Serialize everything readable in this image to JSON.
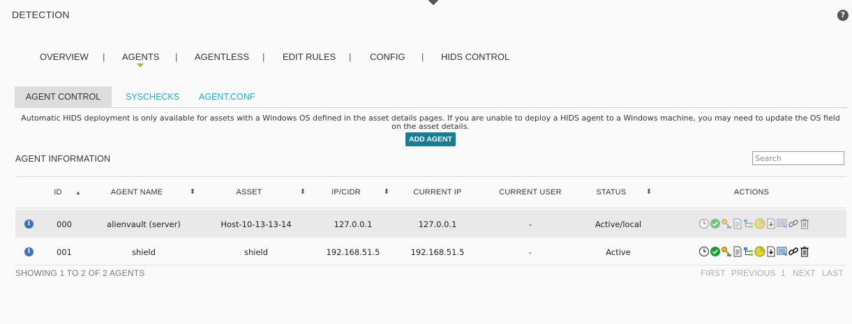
{
  "page": {
    "title": "DETECTION",
    "help_glyph": "?"
  },
  "main_nav": {
    "items": [
      "OVERVIEW",
      "AGENTS",
      "AGENTLESS",
      "EDIT RULES",
      "CONFIG",
      "HIDS CONTROL"
    ],
    "active": "AGENTS",
    "separator": "|"
  },
  "sub_tabs": {
    "items": [
      "AGENT CONTROL",
      "SYSCHECKS",
      "AGENT.CONF"
    ],
    "active": "AGENT CONTROL"
  },
  "notice": "Automatic HIDS deployment is only available for assets with a Windows OS defined in the asset details pages. If you are unable to deploy a HIDS agent to a Windows machine, you may need to update the OS field on the asset details.",
  "add_agent_label": "ADD AGENT",
  "section_title": "AGENT INFORMATION",
  "search": {
    "placeholder": "Search",
    "value": ""
  },
  "table": {
    "columns": [
      "ID",
      "AGENT NAME",
      "ASSET",
      "IP/CIDR",
      "CURRENT IP",
      "CURRENT USER",
      "STATUS",
      "ACTIONS"
    ],
    "sort_column": "ID",
    "sort_direction": "ascending",
    "rows": [
      {
        "id": "000",
        "agent_name": "alienvault (server)",
        "asset": "Host-10-13-13-14",
        "ip_cidr": "127.0.0.1",
        "current_ip": "127.0.0.1",
        "current_user": "-",
        "status": "Active/local",
        "actions_enabled": false
      },
      {
        "id": "001",
        "agent_name": "shield",
        "asset": "shield",
        "ip_cidr": "192.168.51.5",
        "current_ip": "192.168.51.5",
        "current_user": "-",
        "status": "Active",
        "actions_enabled": true
      }
    ],
    "action_icons": [
      "clock-icon",
      "check-circle-icon",
      "key-icon",
      "document-icon",
      "tree-icon",
      "pie-chart-icon",
      "download-icon",
      "monitor-icon",
      "link-icon",
      "trash-icon"
    ]
  },
  "footer": {
    "summary": "SHOWING 1 TO 2 OF 2 AGENTS",
    "pager": {
      "first": "FIRST",
      "previous": "PREVIOUS",
      "page": "1",
      "next": "NEXT",
      "last": "LAST"
    }
  },
  "colors": {
    "accent_link": "#27a9c2",
    "button_bg": "#137e95",
    "active_indicator": "#8ec63f",
    "info_icon": "#3b6fbf"
  }
}
